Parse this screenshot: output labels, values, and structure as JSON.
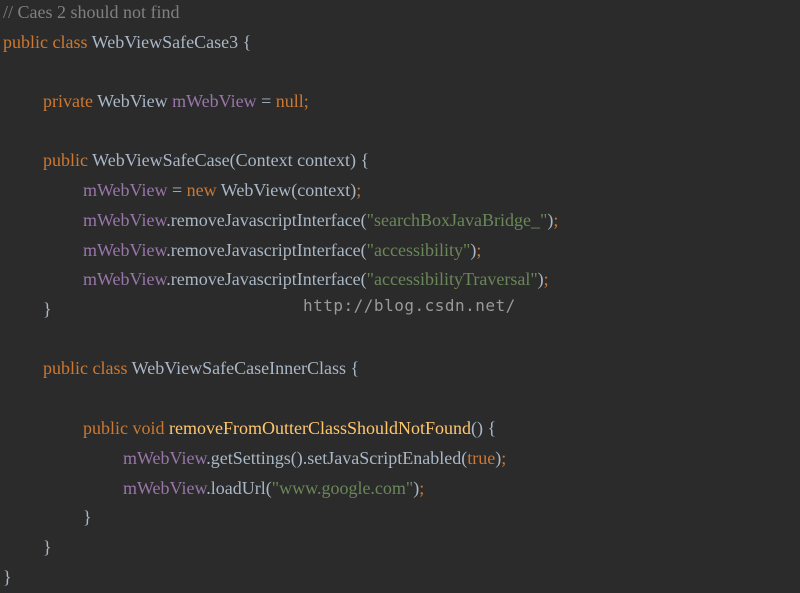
{
  "code_lines": [
    {
      "indent": 0,
      "tokens": [
        {
          "type": "comment",
          "text": "// Caes 2 should not find"
        }
      ]
    },
    {
      "indent": 0,
      "tokens": [
        {
          "type": "kw",
          "text": "public class "
        },
        {
          "type": "plain",
          "text": "WebViewSafeCase3 {"
        }
      ]
    },
    {
      "indent": 1,
      "tokens": [
        {
          "type": "kw",
          "text": "private "
        },
        {
          "type": "plain",
          "text": "WebView "
        },
        {
          "type": "field",
          "text": "mWebView"
        },
        {
          "type": "plain",
          "text": " = "
        },
        {
          "type": "kw",
          "text": "null;"
        }
      ]
    },
    {
      "indent": 1,
      "tokens": [
        {
          "type": "kw",
          "text": "public "
        },
        {
          "type": "plain",
          "text": "WebViewSafeCase(Context context) {"
        }
      ]
    },
    {
      "indent": 2,
      "tokens": [
        {
          "type": "field",
          "text": "mWebView"
        },
        {
          "type": "plain",
          "text": " = "
        },
        {
          "type": "kw",
          "text": "new "
        },
        {
          "type": "plain",
          "text": "WebView(context)"
        },
        {
          "type": "kw",
          "text": ";"
        }
      ]
    },
    {
      "indent": 2,
      "tokens": [
        {
          "type": "field",
          "text": "mWebView"
        },
        {
          "type": "plain",
          "text": ".removeJavascriptInterface("
        },
        {
          "type": "string",
          "text": "\"searchBoxJavaBridge_\""
        },
        {
          "type": "plain",
          "text": ")"
        },
        {
          "type": "kw",
          "text": ";"
        }
      ]
    },
    {
      "indent": 2,
      "tokens": [
        {
          "type": "field",
          "text": "mWebView"
        },
        {
          "type": "plain",
          "text": ".removeJavascriptInterface("
        },
        {
          "type": "string",
          "text": "\"accessibility\""
        },
        {
          "type": "plain",
          "text": ")"
        },
        {
          "type": "kw",
          "text": ";"
        }
      ]
    },
    {
      "indent": 2,
      "tokens": [
        {
          "type": "field",
          "text": "mWebView"
        },
        {
          "type": "plain",
          "text": ".removeJavascriptInterface("
        },
        {
          "type": "string",
          "text": "\"accessibilityTraversal\""
        },
        {
          "type": "plain",
          "text": ")"
        },
        {
          "type": "kw",
          "text": ";"
        }
      ]
    },
    {
      "indent": 1,
      "tokens": [
        {
          "type": "plain",
          "text": "}"
        }
      ]
    },
    {
      "indent": 1,
      "tokens": [
        {
          "type": "kw",
          "text": "public class "
        },
        {
          "type": "plain",
          "text": "WebViewSafeCaseInnerClass {"
        }
      ]
    },
    {
      "indent": 2,
      "tokens": [
        {
          "type": "kw",
          "text": "public void "
        },
        {
          "type": "method",
          "text": "removeFromOutterClassShouldNotFound"
        },
        {
          "type": "plain",
          "text": "() {"
        }
      ]
    },
    {
      "indent": 3,
      "tokens": [
        {
          "type": "field",
          "text": "mWebView"
        },
        {
          "type": "plain",
          "text": ".getSettings().setJavaScriptEnabled("
        },
        {
          "type": "kw",
          "text": "true"
        },
        {
          "type": "plain",
          "text": ")"
        },
        {
          "type": "kw",
          "text": ";"
        }
      ]
    },
    {
      "indent": 3,
      "tokens": [
        {
          "type": "field",
          "text": "mWebView"
        },
        {
          "type": "plain",
          "text": ".loadUrl("
        },
        {
          "type": "string",
          "text": "\"www.google.com\""
        },
        {
          "type": "plain",
          "text": ")"
        },
        {
          "type": "kw",
          "text": ";"
        }
      ]
    },
    {
      "indent": 2,
      "tokens": [
        {
          "type": "plain",
          "text": "}"
        }
      ]
    },
    {
      "indent": 1,
      "tokens": [
        {
          "type": "plain",
          "text": "}"
        }
      ]
    },
    {
      "indent": 0,
      "tokens": [
        {
          "type": "plain",
          "text": "}"
        }
      ]
    }
  ],
  "watermark": "http://blog.csdn.net/",
  "colors": {
    "background": "#2b2b2b",
    "comment": "#808080",
    "keyword": "#cc7832",
    "plain": "#a9b7c6",
    "field": "#9876aa",
    "string": "#6a8759",
    "method": "#ffc66d"
  }
}
